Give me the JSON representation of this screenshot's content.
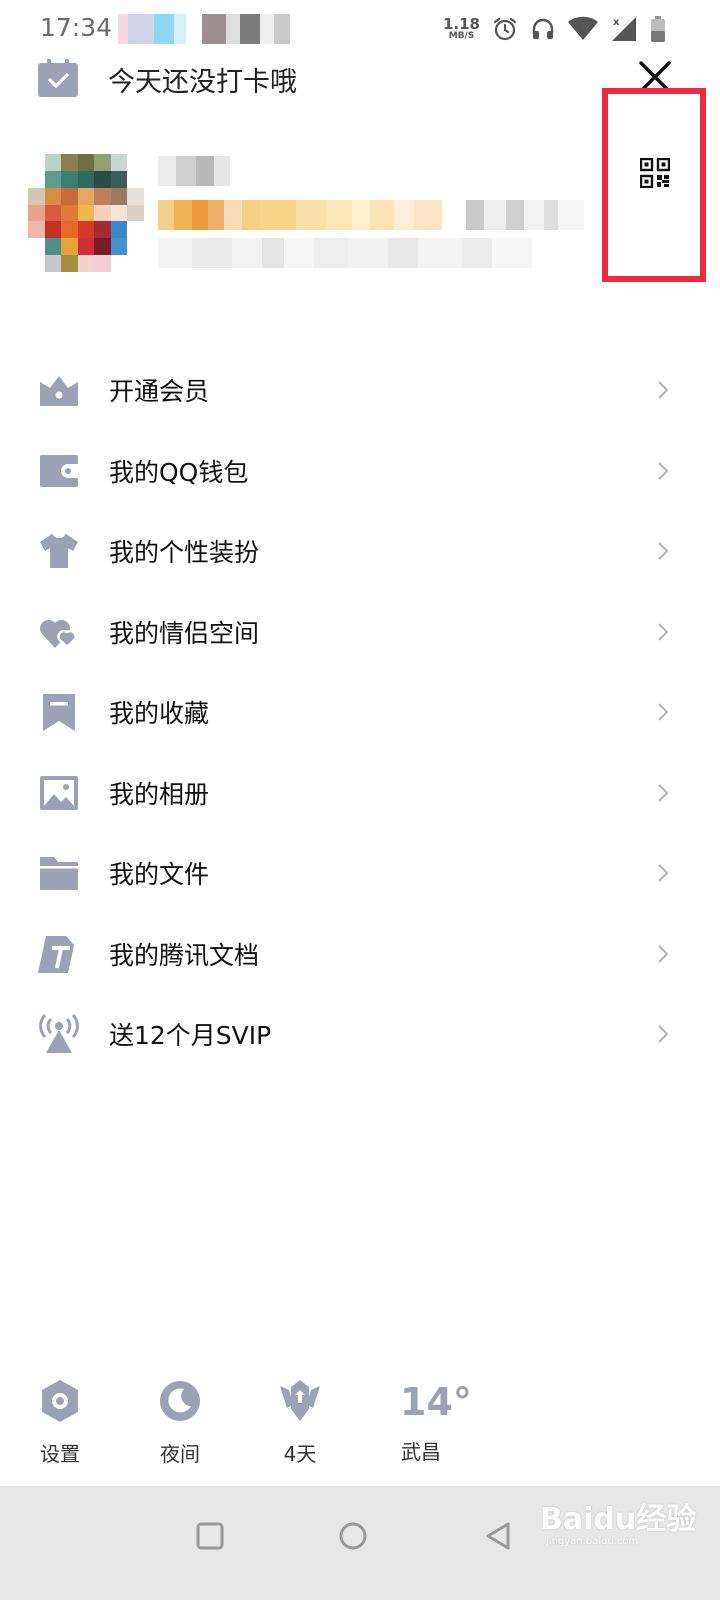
{
  "status_bar": {
    "time": "17:34",
    "net_speed_value": "1.18",
    "net_speed_unit": "MB/S",
    "icons": [
      "alarm-icon",
      "headphones-icon",
      "wifi-icon",
      "signal-icon",
      "battery-icon"
    ]
  },
  "header": {
    "checkin_text": "今天还没打卡哦",
    "close_icon": "close-icon",
    "qr_icon": "qr-code-icon"
  },
  "menu": [
    {
      "label": "开通会员",
      "icon": "crown-icon"
    },
    {
      "label": "我的QQ钱包",
      "icon": "wallet-icon"
    },
    {
      "label": "我的个性装扮",
      "icon": "tshirt-icon"
    },
    {
      "label": "我的情侣空间",
      "icon": "hearts-icon"
    },
    {
      "label": "我的收藏",
      "icon": "bookmark-icon"
    },
    {
      "label": "我的相册",
      "icon": "photo-album-icon"
    },
    {
      "label": "我的文件",
      "icon": "folder-icon"
    },
    {
      "label": "我的腾讯文档",
      "icon": "tencent-docs-icon"
    },
    {
      "label": "送12个月SVIP",
      "icon": "broadcast-icon"
    }
  ],
  "footer": {
    "settings_label": "设置",
    "night_label": "夜间",
    "streak_label": "4天",
    "temperature": "14°",
    "city": "武昌"
  },
  "watermark": {
    "text": "Baidu经验",
    "url_text": "jingyan.baidu.com"
  },
  "colors": {
    "icon_gray": "#9ca1b4",
    "highlight_red": "#ee2a3f",
    "nav_bg": "#e7e7e7"
  }
}
